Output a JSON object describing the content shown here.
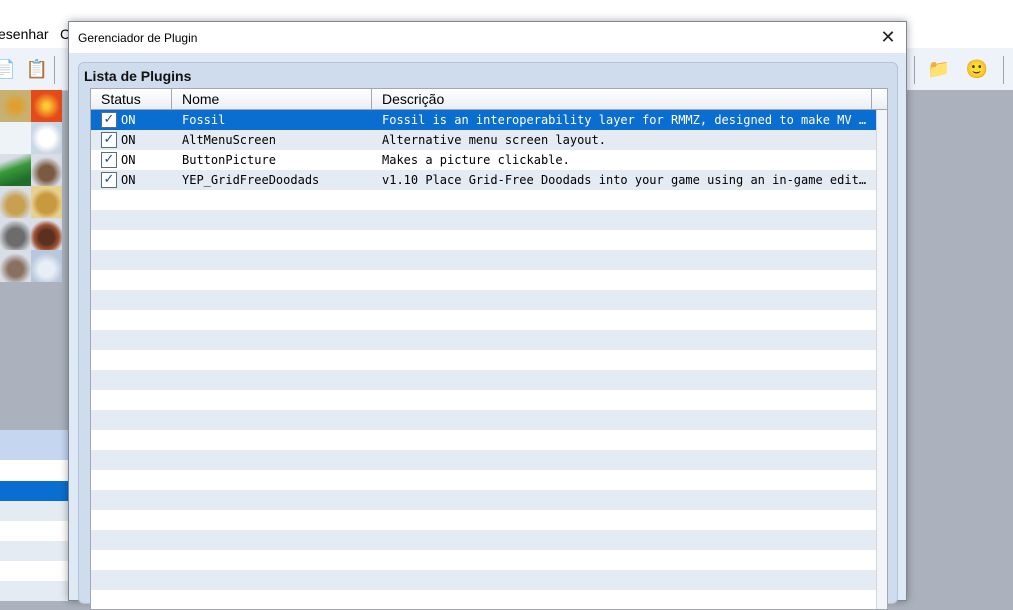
{
  "background": {
    "menubar": {
      "items": [
        "esenhar",
        "C"
      ]
    },
    "toolbar": {
      "icons": [
        "page-icon",
        "clipboard-icon",
        "map-folder-icon",
        "character-face-icon"
      ]
    }
  },
  "dialog": {
    "title": "Gerenciador de Plugin",
    "group_title": "Lista de Plugins",
    "columns": {
      "status": "Status",
      "name": "Nome",
      "description": "Descrição"
    },
    "plugins": [
      {
        "status": "ON",
        "checked": true,
        "name": "Fossil",
        "description": "Fossil is an interoperability layer for RMMZ, designed to make MV p···",
        "selected": true
      },
      {
        "status": "ON",
        "checked": true,
        "name": "AltMenuScreen",
        "description": "Alternative menu screen layout.",
        "selected": false
      },
      {
        "status": "ON",
        "checked": true,
        "name": "ButtonPicture",
        "description": "Makes a picture clickable.",
        "selected": false
      },
      {
        "status": "ON",
        "checked": true,
        "name": "YEP_GridFreeDoodads",
        "description": "v1.10 Place Grid-Free Doodads into your game using an in-game edito···",
        "selected": false
      }
    ],
    "colors": {
      "selected_row": "#0a6ed1",
      "alt_row": "#e5ebf3",
      "accent": "#1a4ea8"
    }
  }
}
